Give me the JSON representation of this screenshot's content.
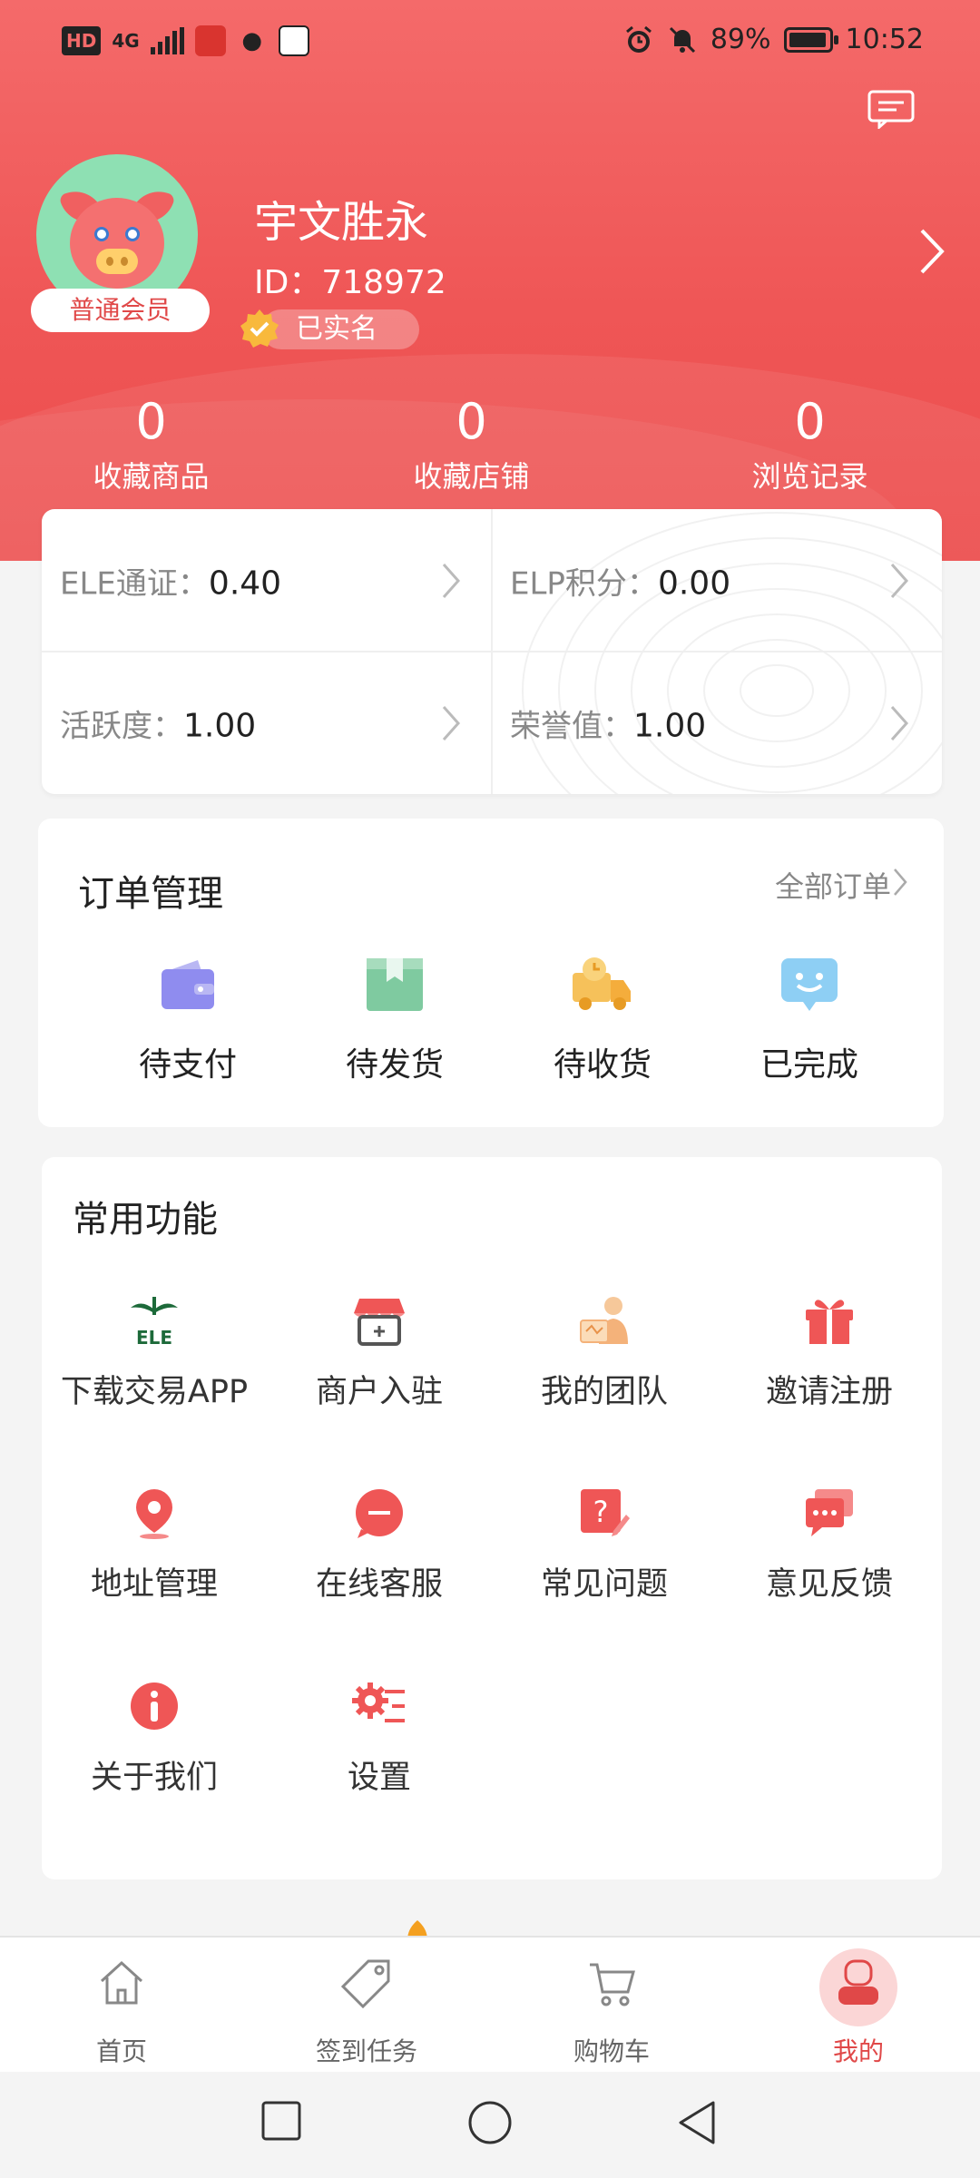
{
  "status_bar": {
    "network": "HD",
    "signal": "4G",
    "battery": "89%",
    "time": "10:52"
  },
  "profile": {
    "name": "宇文胜永",
    "id_text": "ID：718972",
    "member_level": "普通会员",
    "verified_label": "已实名"
  },
  "stats": [
    {
      "value": "0",
      "label": "收藏商品"
    },
    {
      "value": "0",
      "label": "收藏店铺"
    },
    {
      "value": "0",
      "label": "浏览记录"
    }
  ],
  "wallet": [
    {
      "label": "ELE通证：",
      "value": "0.40"
    },
    {
      "label": "ELP积分：",
      "value": "0.00"
    },
    {
      "label": "活跃度：",
      "value": "1.00"
    },
    {
      "label": "荣誉值：",
      "value": "1.00"
    }
  ],
  "orders": {
    "title": "订单管理",
    "all_label": "全部订单",
    "items": [
      {
        "label": "待支付",
        "icon": "wallet-icon"
      },
      {
        "label": "待发货",
        "icon": "box-icon"
      },
      {
        "label": "待收货",
        "icon": "delivery-truck-icon"
      },
      {
        "label": "已完成",
        "icon": "smile-chat-icon"
      }
    ]
  },
  "functions": {
    "title": "常用功能",
    "items": [
      {
        "label": "下载交易APP",
        "icon": "ele-logo-icon"
      },
      {
        "label": "商户入驻",
        "icon": "store-icon"
      },
      {
        "label": "我的团队",
        "icon": "team-icon"
      },
      {
        "label": "邀请注册",
        "icon": "gift-icon"
      },
      {
        "label": "地址管理",
        "icon": "location-pin-icon"
      },
      {
        "label": "在线客服",
        "icon": "chat-bubble-icon"
      },
      {
        "label": "常见问题",
        "icon": "question-icon"
      },
      {
        "label": "意见反馈",
        "icon": "feedback-icon"
      },
      {
        "label": "关于我们",
        "icon": "info-icon"
      },
      {
        "label": "设置",
        "icon": "settings-icon"
      }
    ]
  },
  "bottom_nav": [
    {
      "label": "首页",
      "icon": "home-icon"
    },
    {
      "label": "签到任务",
      "icon": "tag-icon"
    },
    {
      "label": "购物车",
      "icon": "cart-icon"
    },
    {
      "label": "我的",
      "icon": "user-icon",
      "active": true
    }
  ],
  "colors": {
    "brand_red": "#ef5656",
    "accent_text_red": "#e04848",
    "page_background": "#f4f4f4"
  }
}
